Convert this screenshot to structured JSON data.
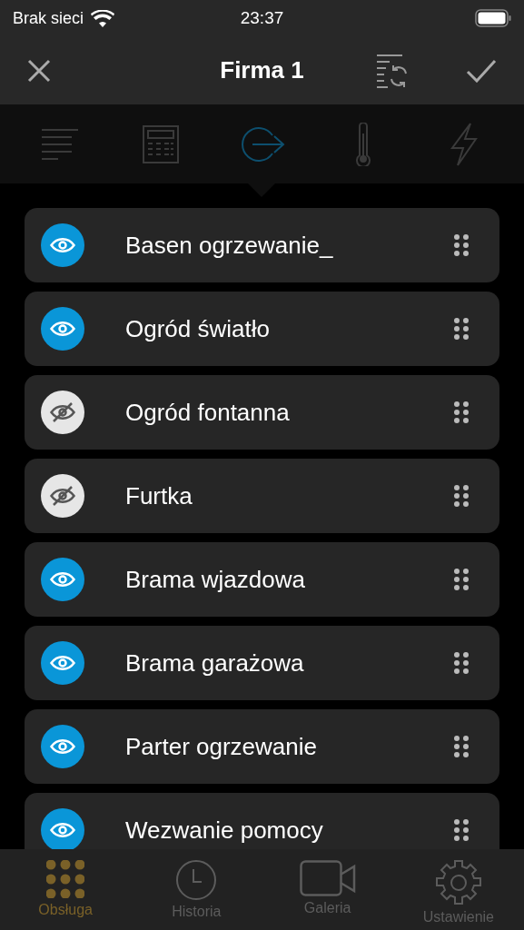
{
  "status_bar": {
    "carrier": "Brak sieci",
    "time": "23:37"
  },
  "nav": {
    "title": "Firma 1"
  },
  "categories": [
    {
      "kind": "text",
      "selected": false
    },
    {
      "kind": "calculator",
      "selected": false
    },
    {
      "kind": "exit",
      "selected": true
    },
    {
      "kind": "thermometer",
      "selected": false
    },
    {
      "kind": "lightning",
      "selected": false
    }
  ],
  "items": [
    {
      "name": "Basen ogrzewanie_",
      "visible": true
    },
    {
      "name": "Ogród światło",
      "visible": true
    },
    {
      "name": "Ogród fontanna",
      "visible": false
    },
    {
      "name": "Furtka",
      "visible": false
    },
    {
      "name": "Brama wjazdowa",
      "visible": true
    },
    {
      "name": "Brama garażowa",
      "visible": true
    },
    {
      "name": "Parter ogrzewanie",
      "visible": true
    },
    {
      "name": "Wezwanie pomocy",
      "visible": true
    }
  ],
  "tab_bar": [
    {
      "kind": "grid",
      "label": "Obsługa",
      "selected": true
    },
    {
      "kind": "clock",
      "label": "Historia",
      "selected": false
    },
    {
      "kind": "camera",
      "label": "Galeria",
      "selected": false
    },
    {
      "kind": "gear",
      "label": "Ustawienie",
      "selected": false
    }
  ]
}
